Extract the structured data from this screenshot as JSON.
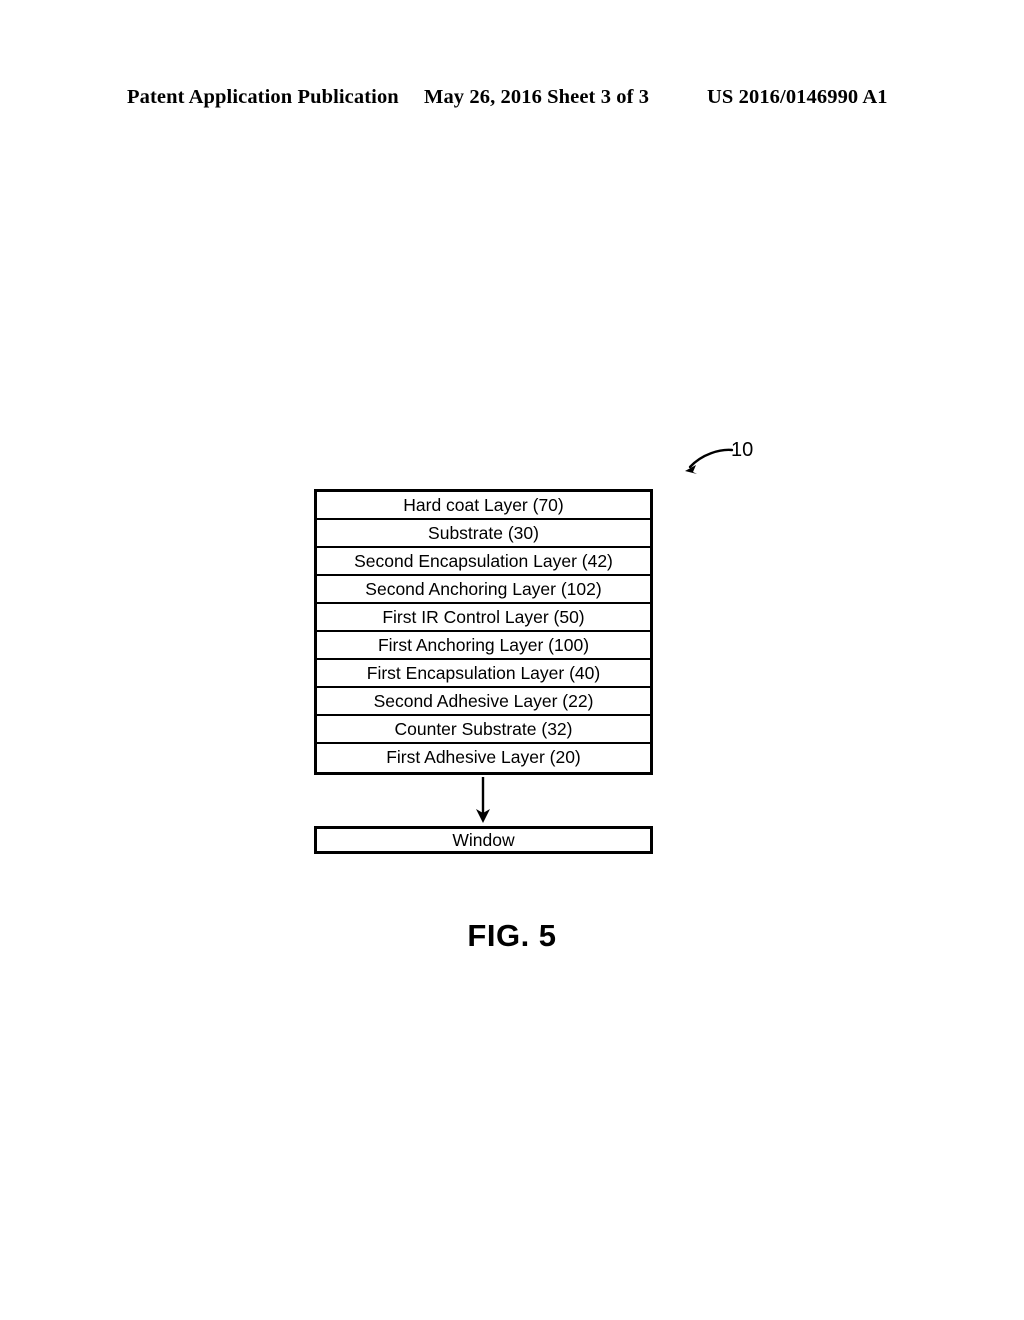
{
  "header": {
    "publication": "Patent Application Publication",
    "date_sheet": "May 26, 2016  Sheet 3 of 3",
    "patent_number": "US 2016/0146990 A1"
  },
  "figure": {
    "caption": "FIG. 5",
    "reference_numeral": "10",
    "stack_rows": [
      {
        "label": "Hard coat Layer (70)"
      },
      {
        "label": "Substrate (30)"
      },
      {
        "label": "Second Encapsulation Layer (42)"
      },
      {
        "label": "Second Anchoring Layer (102)"
      },
      {
        "label": "First IR Control Layer (50)"
      },
      {
        "label": "First Anchoring Layer (100)"
      },
      {
        "label": "First Encapsulation Layer (40)"
      },
      {
        "label": "Second Adhesive Layer (22)"
      },
      {
        "label": "Counter Substrate (32)"
      },
      {
        "label": "First Adhesive Layer (20)"
      }
    ],
    "target_box": {
      "label": "Window"
    },
    "colors": {
      "ink": "#000000",
      "paper": "#ffffff"
    }
  }
}
